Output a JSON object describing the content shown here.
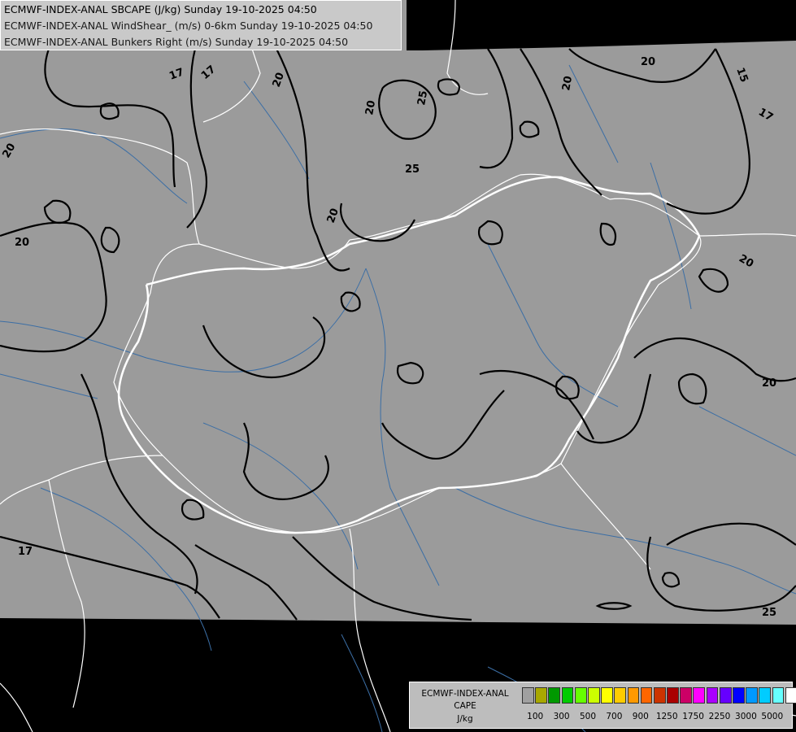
{
  "header": {
    "line1": "ECMWF-INDEX-ANAL SBCAPE (J/kg) Sunday 19-10-2025 04:50",
    "line2": "ECMWF-INDEX-ANAL WindShear_ (m/s) 0-6km Sunday 19-10-2025 04:50",
    "line3": "ECMWF-INDEX-ANAL Bunkers Right (m/s) Sunday 19-10-2025 04:50"
  },
  "legend": {
    "title1": "ECMWF-INDEX-ANAL",
    "title2": "CAPE",
    "title3": "J/kg",
    "colors": [
      "#a0a0a0",
      "#a8a800",
      "#009900",
      "#00cc00",
      "#66ff00",
      "#ccff00",
      "#ffff00",
      "#ffcc00",
      "#ff9900",
      "#ff6600",
      "#cc3300",
      "#aa0000",
      "#cc0066",
      "#ff00ff",
      "#aa00ff",
      "#6600ff",
      "#0000ff",
      "#0099ff",
      "#00ccff",
      "#66ffff",
      "#ffffff"
    ],
    "ticks": [
      "100",
      "300",
      "500",
      "700",
      "900",
      "1250",
      "1750",
      "2250",
      "3000",
      "5000"
    ]
  },
  "contour_labels": [
    "17",
    "17",
    "20",
    "25",
    "20",
    "20",
    "25",
    "20",
    "20",
    "15",
    "17",
    "20",
    "20",
    "20",
    "17",
    "25"
  ],
  "colors": {
    "field": "#9b9b9b",
    "outside": "#000000",
    "border": "#ffffff",
    "river": "#3b6ea5",
    "contour": "#000000"
  }
}
